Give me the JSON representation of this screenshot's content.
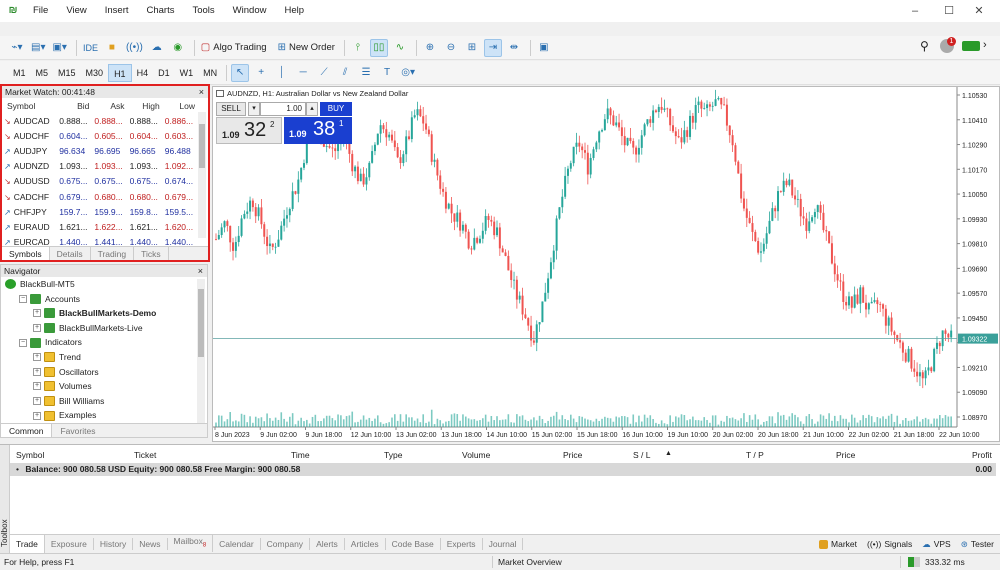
{
  "menubar": {
    "items": [
      "File",
      "View",
      "Insert",
      "Charts",
      "Tools",
      "Window",
      "Help"
    ]
  },
  "toolbar": {
    "ide_label": "IDE",
    "algo_trading_label": "Algo Trading",
    "new_order_label": "New Order",
    "notification_count": "1",
    "timeframes": [
      "M1",
      "M5",
      "M15",
      "M30",
      "H1",
      "H4",
      "D1",
      "W1",
      "MN"
    ],
    "active_timeframe": "H1"
  },
  "market_watch": {
    "title": "Market Watch: 00:41:48",
    "columns": [
      "Symbol",
      "Bid",
      "Ask",
      "High",
      "Low"
    ],
    "rows": [
      {
        "symbol": "AUDCAD",
        "dir": "down",
        "bid": "0.888...",
        "ask": "0.888...",
        "high": "0.888...",
        "low": "0.886...",
        "bid_color": "dark",
        "ask_color": "red"
      },
      {
        "symbol": "AUDCHF",
        "dir": "down",
        "bid": "0.604...",
        "ask": "0.605...",
        "high": "0.604...",
        "low": "0.603...",
        "bid_color": "blue",
        "ask_color": "red"
      },
      {
        "symbol": "AUDJPY",
        "dir": "up",
        "bid": "96.634",
        "ask": "96.695",
        "high": "96.665",
        "low": "96.488",
        "bid_color": "blue",
        "ask_color": "blue"
      },
      {
        "symbol": "AUDNZD",
        "dir": "up",
        "bid": "1.093...",
        "ask": "1.093...",
        "high": "1.093...",
        "low": "1.092...",
        "bid_color": "dark",
        "ask_color": "red"
      },
      {
        "symbol": "AUDUSD",
        "dir": "down",
        "bid": "0.675...",
        "ask": "0.675...",
        "high": "0.675...",
        "low": "0.674...",
        "bid_color": "blue",
        "ask_color": "blue"
      },
      {
        "symbol": "CADCHF",
        "dir": "down",
        "bid": "0.679...",
        "ask": "0.680...",
        "high": "0.680...",
        "low": "0.679...",
        "bid_color": "blue",
        "ask_color": "red"
      },
      {
        "symbol": "CHFJPY",
        "dir": "up",
        "bid": "159.7...",
        "ask": "159.9...",
        "high": "159.8...",
        "low": "159.5...",
        "bid_color": "blue",
        "ask_color": "blue"
      },
      {
        "symbol": "EURAUD",
        "dir": "up",
        "bid": "1.621...",
        "ask": "1.622...",
        "high": "1.621...",
        "low": "1.620...",
        "bid_color": "dark",
        "ask_color": "red"
      },
      {
        "symbol": "EURCAD",
        "dir": "up",
        "bid": "1.440...",
        "ask": "1.441...",
        "high": "1.440...",
        "low": "1.440...",
        "bid_color": "blue",
        "ask_color": "blue"
      }
    ],
    "tabs": [
      "Symbols",
      "Details",
      "Trading",
      "Ticks"
    ],
    "active_tab": "Symbols"
  },
  "navigator": {
    "title": "Navigator",
    "items": [
      {
        "label": "BlackBull-MT5",
        "indent": 0,
        "expander": "",
        "icon": "green",
        "bold": false
      },
      {
        "label": "Accounts",
        "indent": 1,
        "expander": "−",
        "icon": "acct",
        "bold": false
      },
      {
        "label": "BlackBullMarkets-Demo",
        "indent": 2,
        "expander": "+",
        "icon": "acct",
        "bold": true
      },
      {
        "label": "BlackBullMarkets-Live",
        "indent": 2,
        "expander": "+",
        "icon": "acct",
        "bold": false
      },
      {
        "label": "Indicators",
        "indent": 1,
        "expander": "−",
        "icon": "acct",
        "bold": false
      },
      {
        "label": "Trend",
        "indent": 2,
        "expander": "+",
        "icon": "folder",
        "bold": false
      },
      {
        "label": "Oscillators",
        "indent": 2,
        "expander": "+",
        "icon": "folder",
        "bold": false
      },
      {
        "label": "Volumes",
        "indent": 2,
        "expander": "+",
        "icon": "folder",
        "bold": false
      },
      {
        "label": "Bill Williams",
        "indent": 2,
        "expander": "+",
        "icon": "folder",
        "bold": false
      },
      {
        "label": "Examples",
        "indent": 2,
        "expander": "+",
        "icon": "folder",
        "bold": false
      }
    ],
    "tabs": [
      "Common",
      "Favorites"
    ],
    "active_tab": "Common"
  },
  "chart": {
    "title": "AUDNZD, H1:  Australian Dollar vs New Zealand Dollar",
    "one_click": {
      "sell_label": "SELL",
      "buy_label": "BUY",
      "volume": "1.00",
      "sell_prefix": "1.09",
      "sell_big": "32",
      "sell_sup": "2",
      "buy_prefix": "1.09",
      "buy_big": "38",
      "buy_sup": "1"
    },
    "current_price_label": "1.09322",
    "colors": {
      "bull": "#26a69a",
      "bear": "#ef5350",
      "grid": "#e8e8e8",
      "price_line": "#5aa0a0",
      "sell_bg": "#e8e8e8",
      "buy_bg": "#1a3fd0"
    }
  },
  "chart_data": {
    "type": "candlestick",
    "symbol": "AUDNZD",
    "timeframe": "H1",
    "ylim": [
      1.0893,
      1.1054
    ],
    "y_ticks": [
      "1.10530",
      "1.10410",
      "1.10290",
      "1.10170",
      "1.10050",
      "1.09930",
      "1.09810",
      "1.09690",
      "1.09570",
      "1.09450",
      "1.09322",
      "1.09210",
      "1.09090",
      "1.08970"
    ],
    "x_ticks": [
      "8 Jun 2023",
      "9 Jun 02:00",
      "9 Jun 18:00",
      "12 Jun 10:00",
      "13 Jun 02:00",
      "13 Jun 18:00",
      "14 Jun 10:00",
      "15 Jun 02:00",
      "15 Jun 18:00",
      "16 Jun 10:00",
      "19 Jun 10:00",
      "20 Jun 02:00",
      "20 Jun 18:00",
      "21 Jun 10:00",
      "22 Jun 02:00",
      "21 Jun 18:00",
      "22 Jun 10:00"
    ],
    "close_path": [
      1.0982,
      1.099,
      1.0978,
      1.0995,
      1.1002,
      1.099,
      1.0975,
      1.0985,
      1.1,
      1.101,
      1.103,
      1.1038,
      1.103,
      1.1025,
      1.1035,
      1.102,
      1.101,
      1.1018,
      1.104,
      1.1035,
      1.102,
      1.103,
      1.1045,
      1.104,
      1.102,
      1.1005,
      1.0995,
      1.099,
      1.098,
      1.0985,
      1.0992,
      1.0985,
      1.097,
      1.0955,
      1.0945,
      1.0932,
      1.095,
      1.0975,
      1.1,
      1.102,
      1.103,
      1.1018,
      1.1035,
      1.1045,
      1.104,
      1.103,
      1.1025,
      1.1035,
      1.1045,
      1.105,
      1.104,
      1.103,
      1.1038,
      1.1048,
      1.1045,
      1.105,
      1.1045,
      1.103,
      1.1,
      1.0985,
      1.0975,
      1.099,
      1.1005,
      1.101,
      1.1,
      1.099,
      1.1,
      1.0985,
      1.097,
      1.0955,
      1.0948,
      1.0955,
      1.0945,
      1.095,
      1.094,
      1.0932,
      1.0925,
      1.0918,
      1.091,
      1.0922,
      1.0935,
      1.0932
    ]
  },
  "trade": {
    "columns": [
      "Symbol",
      "Ticket",
      "Time",
      "Type",
      "Volume",
      "Price",
      "S / L",
      "T / P",
      "Price",
      "Profit"
    ],
    "balance_text": "Balance: 900 080.58 USD  Equity: 900 080.58  Free Margin: 900 080.58",
    "profit": "0.00",
    "tabs": [
      "Trade",
      "Exposure",
      "History",
      "News",
      "Mailbox",
      "Calendar",
      "Company",
      "Alerts",
      "Articles",
      "Code Base",
      "Experts",
      "Journal"
    ],
    "mailbox_count": "8",
    "active_tab": "Trade",
    "toolbox_label": "Toolbox",
    "right_items": [
      "Market",
      "Signals",
      "VPS",
      "Tester"
    ]
  },
  "status": {
    "help": "For Help, press F1",
    "overview": "Market Overview",
    "traffic": "333.32 ms"
  }
}
